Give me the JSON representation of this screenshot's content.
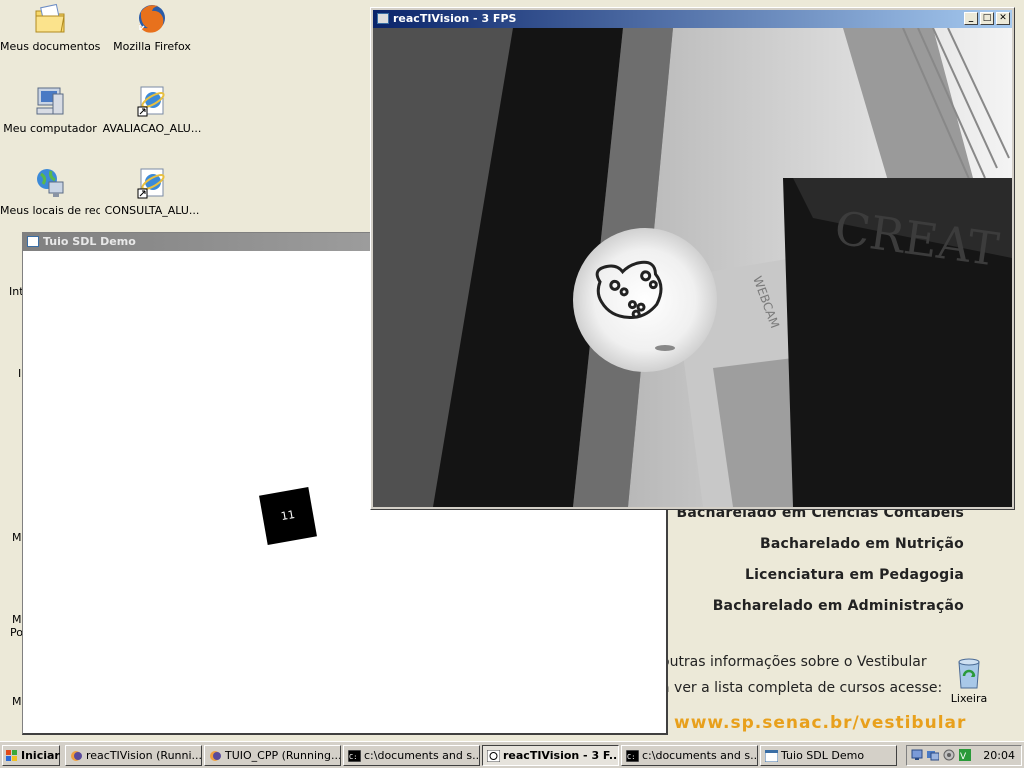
{
  "desktop": {
    "icons": [
      {
        "label": "Meus documentos",
        "icon": "folder-documents-icon"
      },
      {
        "label": "Mozilla Firefox",
        "icon": "firefox-icon"
      },
      {
        "label": "Meu computador",
        "icon": "my-computer-icon"
      },
      {
        "label": "AVALIACAO_ALU...",
        "icon": "ie-shortcut-icon"
      },
      {
        "label": "Meus locais de rede",
        "icon": "network-places-icon"
      },
      {
        "label": "CONSULTA_ALU...",
        "icon": "ie-shortcut-icon"
      },
      {
        "label": "Lixeira",
        "icon": "recycle-bin-icon"
      }
    ],
    "partial_labels": [
      "Int",
      "I",
      "Mi",
      "Mi",
      "Po",
      "Mi"
    ]
  },
  "wallpaper": {
    "courses": [
      "Bacharelado em Ciências Contábeis",
      "Bacharelado em Nutrição",
      "Licenciatura em Pedagogia",
      "Bacharelado em Administração"
    ],
    "info_line1": "outras informações sobre o Vestibular",
    "info_line2": "a ver a lista completa de cursos acesse:",
    "url": "www.sp.senac.br/vestibular"
  },
  "windows": {
    "tuio": {
      "title": "Tuio SDL Demo",
      "marker_id": "11"
    },
    "reactivision": {
      "title": "reacTIVision - 3 FPS",
      "camera_text": "CREAT",
      "camera_side_text": "WEBCAM"
    }
  },
  "taskbar": {
    "start_label": "Iniciar",
    "tasks": [
      {
        "label": "reacTIVision (Runni...",
        "active": false
      },
      {
        "label": "TUIO_CPP (Running...",
        "active": false
      },
      {
        "label": "c:\\documents and s...",
        "active": false
      },
      {
        "label": "reacTIVision - 3 F...",
        "active": true
      },
      {
        "label": "c:\\documents and s...",
        "active": false
      },
      {
        "label": "Tuio SDL Demo",
        "active": false
      }
    ],
    "clock": "20:04"
  },
  "colors": {
    "desktop_bg": "#ece9d8",
    "active_title": "#0a246a",
    "inactive_title": "#808080",
    "url_orange": "#e8a01c"
  }
}
